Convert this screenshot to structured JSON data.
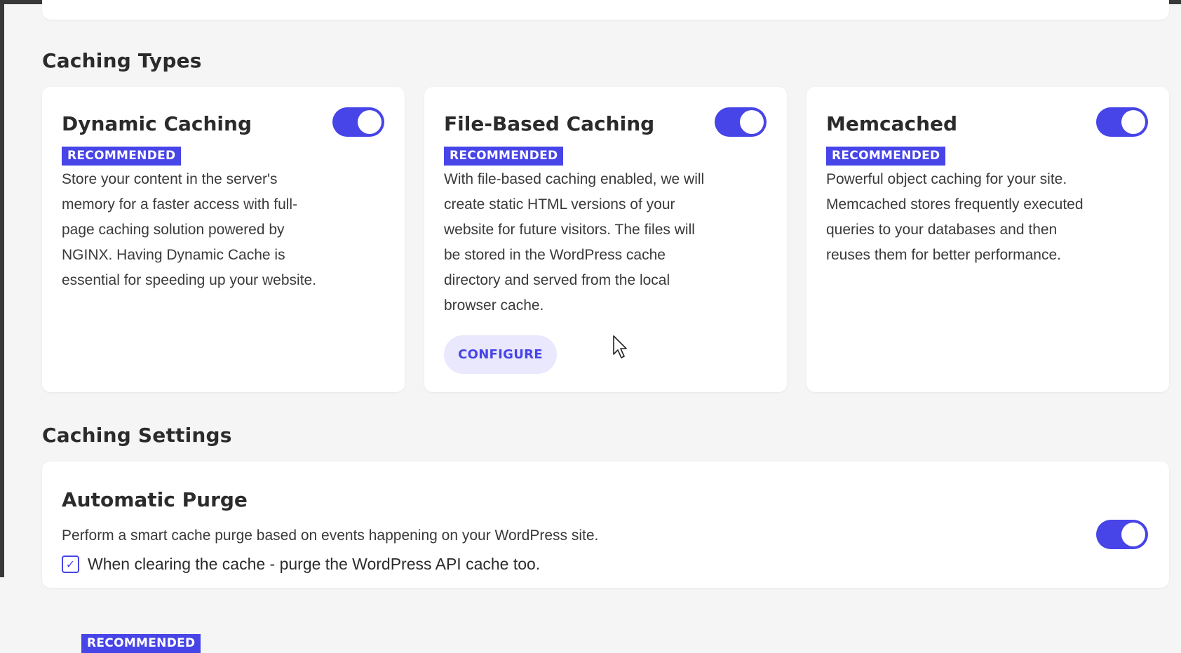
{
  "caching_types": {
    "heading": "Caching Types",
    "cards": [
      {
        "title": "Dynamic Caching",
        "badge": "RECOMMENDED",
        "description": "Store your content in the server's memory for a faster access with full-page caching solution powered by NGINX. Having Dynamic Cache is essential for speeding up your website.",
        "enabled": true
      },
      {
        "title": "File-Based Caching",
        "badge": "RECOMMENDED",
        "description": "With file-based caching enabled, we will create static HTML versions of your website for future visitors. The files will be stored in the WordPress cache directory and served from the local browser cache.",
        "enabled": true,
        "button_label": "CONFIGURE"
      },
      {
        "title": "Memcached",
        "badge": "RECOMMENDED",
        "description": "Powerful object caching for your site. Memcached stores frequently executed queries to your databases and then reuses them for better performance.",
        "enabled": true
      }
    ]
  },
  "caching_settings": {
    "heading": "Caching Settings",
    "automatic_purge": {
      "title": "Automatic Purge",
      "badge": "RECOMMENDED",
      "description": "Perform a smart cache purge based on events happening on your WordPress site.",
      "enabled": true,
      "checkbox_label": "When clearing the cache - purge the WordPress API cache too.",
      "checkbox_checked": true
    }
  },
  "colors": {
    "accent": "#4744e8",
    "accent_light": "#e9e8fc",
    "background": "#f5f5f5",
    "card": "#ffffff",
    "text": "#2b2b2b"
  },
  "icons": {
    "checkbox": "check-icon",
    "cursor": "mouse-pointer-icon"
  }
}
